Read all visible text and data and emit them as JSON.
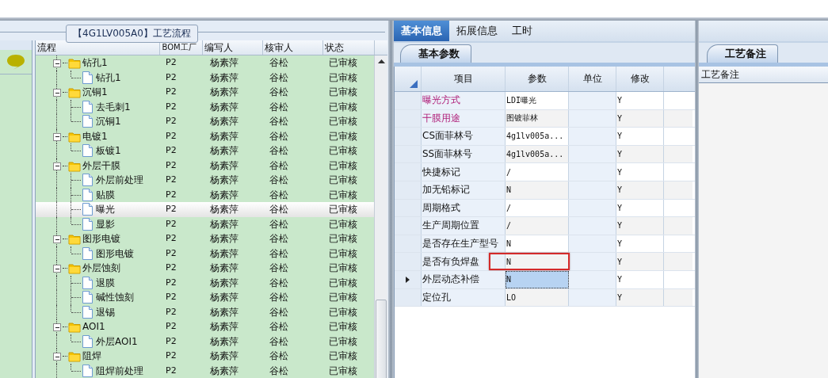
{
  "tree": {
    "title": "【4G1LV005A0】工艺流程",
    "columns": [
      "流程",
      "BOM工厂",
      "编写人",
      "核审人",
      "状态"
    ],
    "nodes": [
      {
        "name": "钻孔1",
        "bom": "P2",
        "author": "杨素萍",
        "reviewer": "谷松",
        "status": "已审核",
        "expanded": true,
        "selected": false,
        "children": [
          {
            "name": "钻孔1",
            "bom": "P2",
            "author": "杨素萍",
            "reviewer": "谷松",
            "status": "已审核",
            "selected": false
          }
        ]
      },
      {
        "name": "沉铜1",
        "bom": "P2",
        "author": "杨素萍",
        "reviewer": "谷松",
        "status": "已审核",
        "expanded": true,
        "selected": false,
        "children": [
          {
            "name": "去毛刺1",
            "bom": "P2",
            "author": "杨素萍",
            "reviewer": "谷松",
            "status": "已审核",
            "selected": false
          },
          {
            "name": "沉铜1",
            "bom": "P2",
            "author": "杨素萍",
            "reviewer": "谷松",
            "status": "已审核",
            "selected": false
          }
        ]
      },
      {
        "name": "电镀1",
        "bom": "P2",
        "author": "杨素萍",
        "reviewer": "谷松",
        "status": "已审核",
        "expanded": true,
        "selected": false,
        "children": [
          {
            "name": "板镀1",
            "bom": "P2",
            "author": "杨素萍",
            "reviewer": "谷松",
            "status": "已审核",
            "selected": false
          }
        ]
      },
      {
        "name": "外层干膜",
        "bom": "P2",
        "author": "杨素萍",
        "reviewer": "谷松",
        "status": "已审核",
        "expanded": true,
        "selected": false,
        "children": [
          {
            "name": "外层前处理",
            "bom": "P2",
            "author": "杨素萍",
            "reviewer": "谷松",
            "status": "已审核",
            "selected": false
          },
          {
            "name": "贴膜",
            "bom": "P2",
            "author": "杨素萍",
            "reviewer": "谷松",
            "status": "已审核",
            "selected": false
          },
          {
            "name": "曝光",
            "bom": "P2",
            "author": "杨素萍",
            "reviewer": "谷松",
            "status": "已审核",
            "selected": true
          },
          {
            "name": "显影",
            "bom": "P2",
            "author": "杨素萍",
            "reviewer": "谷松",
            "status": "已审核",
            "selected": false
          }
        ]
      },
      {
        "name": "图形电镀",
        "bom": "P2",
        "author": "杨素萍",
        "reviewer": "谷松",
        "status": "已审核",
        "expanded": true,
        "selected": false,
        "children": [
          {
            "name": "图形电镀",
            "bom": "P2",
            "author": "杨素萍",
            "reviewer": "谷松",
            "status": "已审核",
            "selected": false
          }
        ]
      },
      {
        "name": "外层蚀刻",
        "bom": "P2",
        "author": "杨素萍",
        "reviewer": "谷松",
        "status": "已审核",
        "expanded": true,
        "selected": false,
        "children": [
          {
            "name": "退膜",
            "bom": "P2",
            "author": "杨素萍",
            "reviewer": "谷松",
            "status": "已审核",
            "selected": false
          },
          {
            "name": "碱性蚀刻",
            "bom": "P2",
            "author": "杨素萍",
            "reviewer": "谷松",
            "status": "已审核",
            "selected": false
          },
          {
            "name": "退锡",
            "bom": "P2",
            "author": "杨素萍",
            "reviewer": "谷松",
            "status": "已审核",
            "selected": false
          }
        ]
      },
      {
        "name": "AOI1",
        "bom": "P2",
        "author": "杨素萍",
        "reviewer": "谷松",
        "status": "已审核",
        "expanded": true,
        "selected": false,
        "children": [
          {
            "name": "外层AOI1",
            "bom": "P2",
            "author": "杨素萍",
            "reviewer": "谷松",
            "status": "已审核",
            "selected": false
          }
        ]
      },
      {
        "name": "阻焊",
        "bom": "P2",
        "author": "杨素萍",
        "reviewer": "谷松",
        "status": "已审核",
        "expanded": true,
        "selected": false,
        "children": [
          {
            "name": "阻焊前处理",
            "bom": "P2",
            "author": "杨素萍",
            "reviewer": "谷松",
            "status": "已审核",
            "selected": false
          }
        ]
      }
    ]
  },
  "tabs": [
    {
      "label": "基本信息",
      "selected": true
    },
    {
      "label": "拓展信息",
      "selected": false
    },
    {
      "label": "工时",
      "selected": false
    }
  ],
  "subtab": {
    "label": "基本参数"
  },
  "params": {
    "columns": [
      "项目",
      "参数",
      "单位",
      "修改"
    ],
    "rows": [
      {
        "item": "曝光方式",
        "value": "LDI曝光",
        "modify": "Y",
        "required": true,
        "current": false,
        "annotated": false
      },
      {
        "item": "干膜用途",
        "value": "图镀菲林",
        "modify": "Y",
        "required": true,
        "current": false,
        "annotated": false
      },
      {
        "item": "CS面菲林号",
        "value": "4g1lv005a...",
        "modify": "Y",
        "required": false,
        "current": false,
        "annotated": false
      },
      {
        "item": "SS面菲林号",
        "value": "4g1lv005a...",
        "modify": "Y",
        "required": false,
        "current": false,
        "annotated": false
      },
      {
        "item": "快捷标记",
        "value": "/",
        "modify": "Y",
        "required": false,
        "current": false,
        "annotated": false
      },
      {
        "item": "加无铅标记",
        "value": "N",
        "modify": "Y",
        "required": false,
        "current": false,
        "annotated": false
      },
      {
        "item": "周期格式",
        "value": "/",
        "modify": "Y",
        "required": false,
        "current": false,
        "annotated": false
      },
      {
        "item": "生产周期位置",
        "value": "/",
        "modify": "Y",
        "required": false,
        "current": false,
        "annotated": false
      },
      {
        "item": "是否存在生产型号",
        "value": "N",
        "modify": "Y",
        "required": false,
        "current": false,
        "annotated": false
      },
      {
        "item": "是否有负焊盘",
        "value": "N",
        "modify": "Y",
        "required": false,
        "current": false,
        "annotated": true
      },
      {
        "item": "外层动态补偿",
        "value": "N",
        "modify": "Y",
        "required": false,
        "current": true,
        "annotated": false
      },
      {
        "item": "定位孔",
        "value": "LO",
        "modify": "Y",
        "required": false,
        "current": false,
        "annotated": false
      }
    ]
  },
  "notes": {
    "tab": "工艺备注",
    "header": "工艺备注"
  }
}
